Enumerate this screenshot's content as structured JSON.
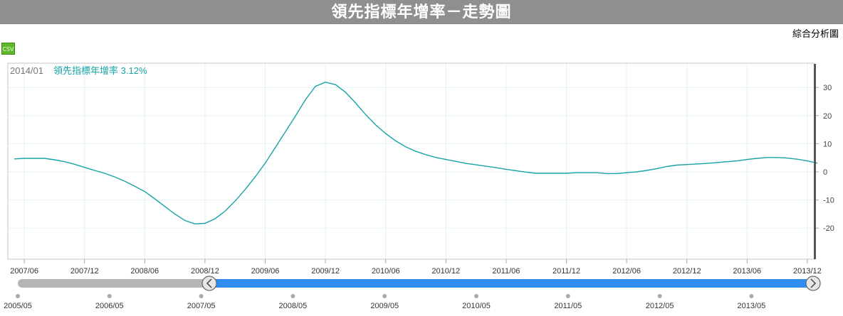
{
  "page_title": "領先指標年增率－走勢圖",
  "analysis_link": "綜合分析圖",
  "csv_label": "CSV",
  "colors": {
    "line": "#17a3a6",
    "title_bar": "#8f8f8f",
    "navigator_selected": "#2f8cf0",
    "navigator_track": "#b5b5b5"
  },
  "chart_data": {
    "type": "line",
    "tooltip": {
      "date": "2014/01",
      "series": "領先指標年增率",
      "value": "3.12%"
    },
    "ylim": [
      -30,
      35
    ],
    "y_ticks": [
      30,
      20,
      10,
      0,
      -10,
      -20
    ],
    "x_tick_labels": [
      "2007/06",
      "2007/12",
      "2008/06",
      "2008/12",
      "2009/06",
      "2009/12",
      "2010/06",
      "2010/12",
      "2011/06",
      "2011/12",
      "2012/06",
      "2012/12",
      "2013/06",
      "2013/12"
    ],
    "navigator_labels": [
      "2005/05",
      "2006/05",
      "2007/05",
      "2008/05",
      "2009/05",
      "2010/05",
      "2011/05",
      "2012/05",
      "2013/05"
    ],
    "series": [
      {
        "x": [
          "2007/05",
          "2007/06",
          "2007/07",
          "2007/08",
          "2007/09",
          "2007/10",
          "2007/11",
          "2007/12",
          "2008/01",
          "2008/02",
          "2008/03",
          "2008/04",
          "2008/05",
          "2008/06",
          "2008/07",
          "2008/08",
          "2008/09",
          "2008/10",
          "2008/11",
          "2008/12",
          "2009/01",
          "2009/02",
          "2009/03",
          "2009/04",
          "2009/05",
          "2009/06",
          "2009/07",
          "2009/08",
          "2009/09",
          "2009/10",
          "2009/11",
          "2009/12",
          "2010/01",
          "2010/02",
          "2010/03",
          "2010/04",
          "2010/05",
          "2010/06",
          "2010/07",
          "2010/08",
          "2010/09",
          "2010/10",
          "2010/11",
          "2010/12",
          "2011/01",
          "2011/02",
          "2011/03",
          "2011/04",
          "2011/05",
          "2011/06",
          "2011/07",
          "2011/08",
          "2011/09",
          "2011/10",
          "2011/11",
          "2011/12",
          "2012/01",
          "2012/02",
          "2012/03",
          "2012/04",
          "2012/05",
          "2012/06",
          "2012/07",
          "2012/08",
          "2012/09",
          "2012/10",
          "2012/11",
          "2012/12",
          "2013/01",
          "2013/02",
          "2013/03",
          "2013/04",
          "2013/05",
          "2013/06",
          "2013/07",
          "2013/08",
          "2013/09",
          "2013/10",
          "2013/11",
          "2013/12",
          "2014/01"
        ],
        "values": [
          4.6,
          4.8,
          4.8,
          4.8,
          4.3,
          3.6,
          2.7,
          1.6,
          0.5,
          -0.5,
          -1.8,
          -3.3,
          -5.1,
          -7.0,
          -9.6,
          -12.3,
          -15.0,
          -17.3,
          -18.5,
          -18.3,
          -16.7,
          -14.0,
          -10.4,
          -6.3,
          -1.8,
          3.1,
          8.6,
          14.2,
          19.8,
          25.6,
          30.4,
          31.9,
          31.0,
          28.3,
          24.5,
          20.4,
          16.7,
          13.6,
          11.0,
          8.9,
          7.3,
          6.1,
          5.1,
          4.4,
          3.7,
          3.0,
          2.5,
          2.0,
          1.5,
          0.9,
          0.4,
          -0.1,
          -0.5,
          -0.5,
          -0.5,
          -0.5,
          -0.3,
          -0.3,
          -0.3,
          -0.6,
          -0.6,
          -0.3,
          0.0,
          0.5,
          1.1,
          1.9,
          2.4,
          2.6,
          2.8,
          3.0,
          3.3,
          3.6,
          3.9,
          4.4,
          4.8,
          5.1,
          5.1,
          4.9,
          4.5,
          3.9,
          3.1
        ]
      }
    ]
  }
}
